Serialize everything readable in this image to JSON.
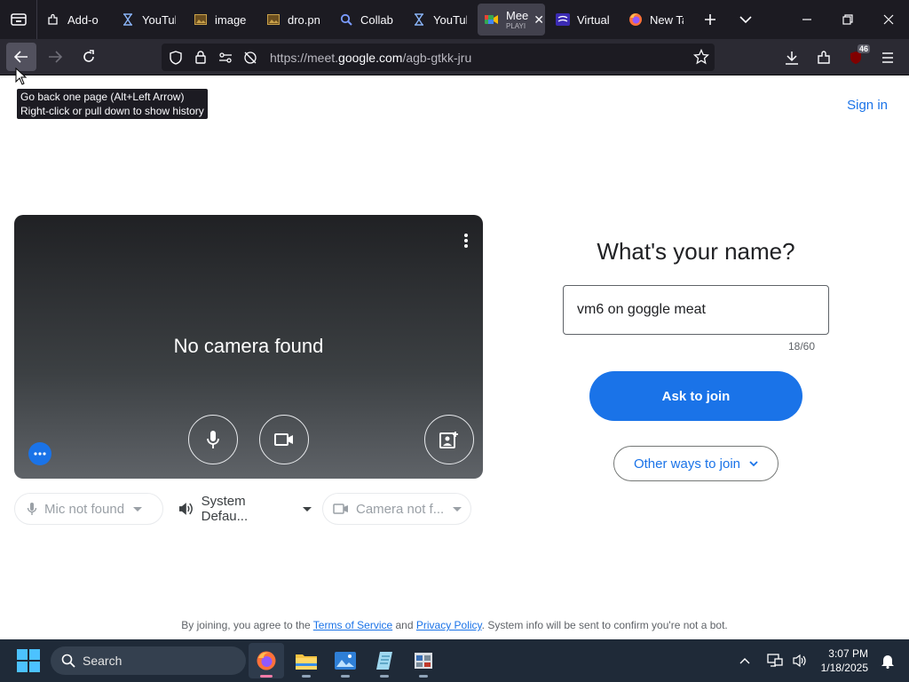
{
  "browser": {
    "tabs": [
      {
        "title": "Add-o",
        "icon": "puzzle-icon"
      },
      {
        "title": "YouTul",
        "icon": "hourglass-icon"
      },
      {
        "title": "image",
        "icon": "image-icon"
      },
      {
        "title": "dro.pn",
        "icon": "image-icon"
      },
      {
        "title": "Collab",
        "icon": "search-icon"
      },
      {
        "title": "YouTul",
        "icon": "hourglass-icon"
      },
      {
        "title": "Mee",
        "subtitle": "PLAYI",
        "icon": "meet-icon",
        "active": true
      },
      {
        "title": "Virtual",
        "icon": "virtual-icon"
      },
      {
        "title": "New Ta",
        "icon": "firefox-icon"
      }
    ],
    "url_prefix": "https://meet.",
    "url_host": "google.com",
    "url_path": "/agb-gtkk-jru",
    "extension_badge": "46",
    "tooltip_line1": "Go back one page (Alt+Left Arrow)",
    "tooltip_line2": "Right-click or pull down to show history"
  },
  "meet": {
    "sign_in": "Sign in",
    "preview_message": "No camera found",
    "mic_device": "Mic not found",
    "speaker_device": "System Defau...",
    "camera_device": "Camera not f...",
    "name_prompt": "What's your name?",
    "name_value": "vm6 on goggle meat",
    "name_counter": "18/60",
    "ask_button": "Ask to join",
    "other_ways_button": "Other ways to join",
    "legal_prefix": "By joining, you agree to the ",
    "terms_link": "Terms of Service",
    "legal_and": " and ",
    "privacy_link": "Privacy Policy",
    "legal_suffix": ". System info will be sent to confirm you're not a bot.",
    "colors": {
      "accent": "#1a73e8"
    }
  },
  "taskbar": {
    "search_label": "Search",
    "time": "3:07 PM",
    "date": "1/18/2025"
  }
}
